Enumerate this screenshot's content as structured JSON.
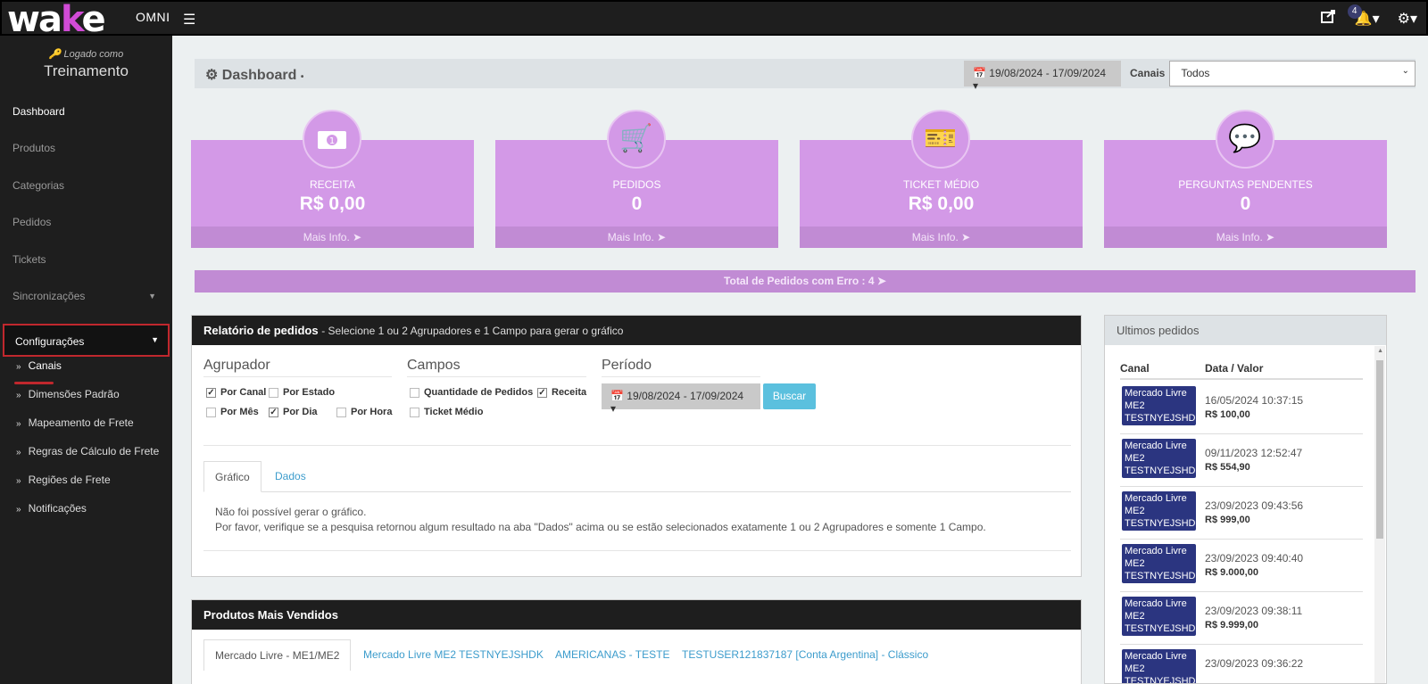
{
  "topbar": {
    "logo_prefix": "wa",
    "logo_k": "k",
    "logo_suffix": "e",
    "logo_omni": "OMNI",
    "notification_count": "4"
  },
  "sidebar": {
    "logged_as": "Logado como",
    "org": "Treinamento",
    "items": [
      {
        "label": "Dashboard"
      },
      {
        "label": "Produtos"
      },
      {
        "label": "Categorias"
      },
      {
        "label": "Pedidos"
      },
      {
        "label": "Tickets"
      },
      {
        "label": "Sincronizações"
      }
    ],
    "config_label": "Configurações",
    "sub_items": [
      {
        "label": "Canais"
      },
      {
        "label": "Dimensões Padrão"
      },
      {
        "label": "Mapeamento de Frete"
      },
      {
        "label": "Regras de Cálculo de Frete"
      },
      {
        "label": "Regiões de Frete"
      },
      {
        "label": "Notificações"
      }
    ]
  },
  "header": {
    "title": "Dashboard",
    "date_range": "19/08/2024 - 17/09/2024",
    "canais_label": "Canais",
    "canais_value": "Todos"
  },
  "cards": [
    {
      "label": "RECEITA",
      "value": "R$ 0,00",
      "footer": "Mais Info."
    },
    {
      "label": "PEDIDOS",
      "value": "0",
      "footer": "Mais Info."
    },
    {
      "label": "TICKET MÉDIO",
      "value": "R$ 0,00",
      "footer": "Mais Info."
    },
    {
      "label": "PERGUNTAS PENDENTES",
      "value": "0",
      "footer": "Mais Info."
    }
  ],
  "error_bar": "Total de Pedidos com Erro : 4",
  "relatorio": {
    "title": "Relatório de pedidos",
    "subtitle": "- Selecione 1 ou 2 Agrupadores e 1 Campo para gerar o gráfico",
    "agrupador_title": "Agrupador",
    "campos_title": "Campos",
    "periodo_title": "Período",
    "agrupador_options": [
      "Por Canal",
      "Por Estado",
      "Por Mês",
      "Por Dia",
      "Por Hora"
    ],
    "campos_options": [
      "Quantidade de Pedidos",
      "Receita",
      "Ticket Médio"
    ],
    "periodo_value": "19/08/2024 - 17/09/2024",
    "buscar": "Buscar",
    "tab_grafico": "Gráfico",
    "tab_dados": "Dados",
    "msg_line1": "Não foi possível gerar o gráfico.",
    "msg_line2": "Por favor, verifique se a pesquisa retornou algum resultado na aba \"Dados\" acima ou se estão selecionados exatamente 1 ou 2 Agrupadores e somente 1 Campo."
  },
  "ultimos": {
    "title": "Ultimos pedidos",
    "col_canal": "Canal",
    "col_data": "Data / Valor",
    "badge": "Mercado Livre ME2 TESTNYEJSHDK",
    "rows": [
      {
        "date": "16/05/2024 10:37:15",
        "value": "R$ 100,00"
      },
      {
        "date": "09/11/2023 12:52:47",
        "value": "R$ 554,90"
      },
      {
        "date": "23/09/2023 09:43:56",
        "value": "R$ 999,00"
      },
      {
        "date": "23/09/2023 09:40:40",
        "value": "R$ 9.000,00"
      },
      {
        "date": "23/09/2023 09:38:11",
        "value": "R$ 9.999,00"
      },
      {
        "date": "23/09/2023 09:36:22",
        "value": ""
      }
    ]
  },
  "produtos": {
    "title": "Produtos Mais Vendidos",
    "tabs": [
      "Mercado Livre - ME1/ME2",
      "Mercado Livre ME2 TESTNYEJSHDK",
      "AMERICANAS - TESTE",
      "TESTUSER121837187 [Conta Argentina] - Clássico"
    ]
  }
}
